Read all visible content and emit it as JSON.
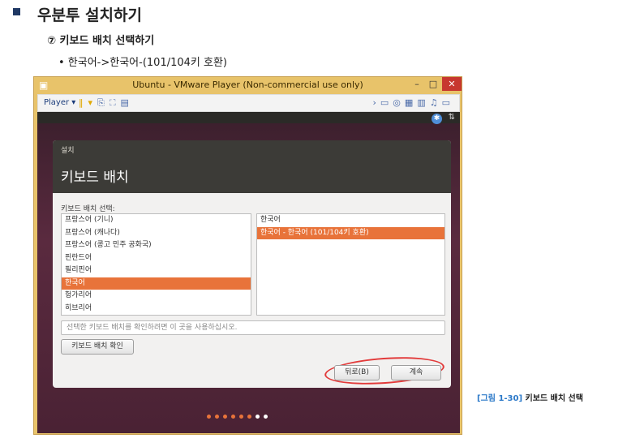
{
  "doc": {
    "heading": "우분투 설치하기",
    "step": "⑦ 키보드 배치 선택하기",
    "bullet": "• 한국어->한국어-(101/104키 호환)"
  },
  "window": {
    "title": "Ubuntu - VMware Player (Non-commercial use only)",
    "toolbar_player": "Player ▾"
  },
  "dialog": {
    "small_title": "설치",
    "title": "키보드 배치",
    "select_label": "키보드 배치 선택:",
    "left_list": [
      "프랑스어 (기니)",
      "프랑스어 (캐나다)",
      "프랑스어 (콩고 민주 공화국)",
      "핀란드어",
      "필리핀어",
      "한국어",
      "헝가리어",
      "히브리어"
    ],
    "left_selected_index": 5,
    "right_list": [
      "한국어",
      "한국어 - 한국어 (101/104키 호환)"
    ],
    "right_selected_index": 1,
    "test_placeholder": "선택한 키보드 배치를 확인하려면 이 곳을 사용하십시오.",
    "detect_button": "키보드 배치 확인",
    "back_button": "뒤로(B)",
    "next_button": "계속"
  },
  "progress": {
    "total": 7,
    "done": 6
  },
  "caption": {
    "number": "[그림 1-30]",
    "text": "키보드 배치 선택"
  },
  "colors": {
    "accent": "#e8733a",
    "title_bar": "#e8c36a",
    "dialog_header": "#3c3b37"
  }
}
